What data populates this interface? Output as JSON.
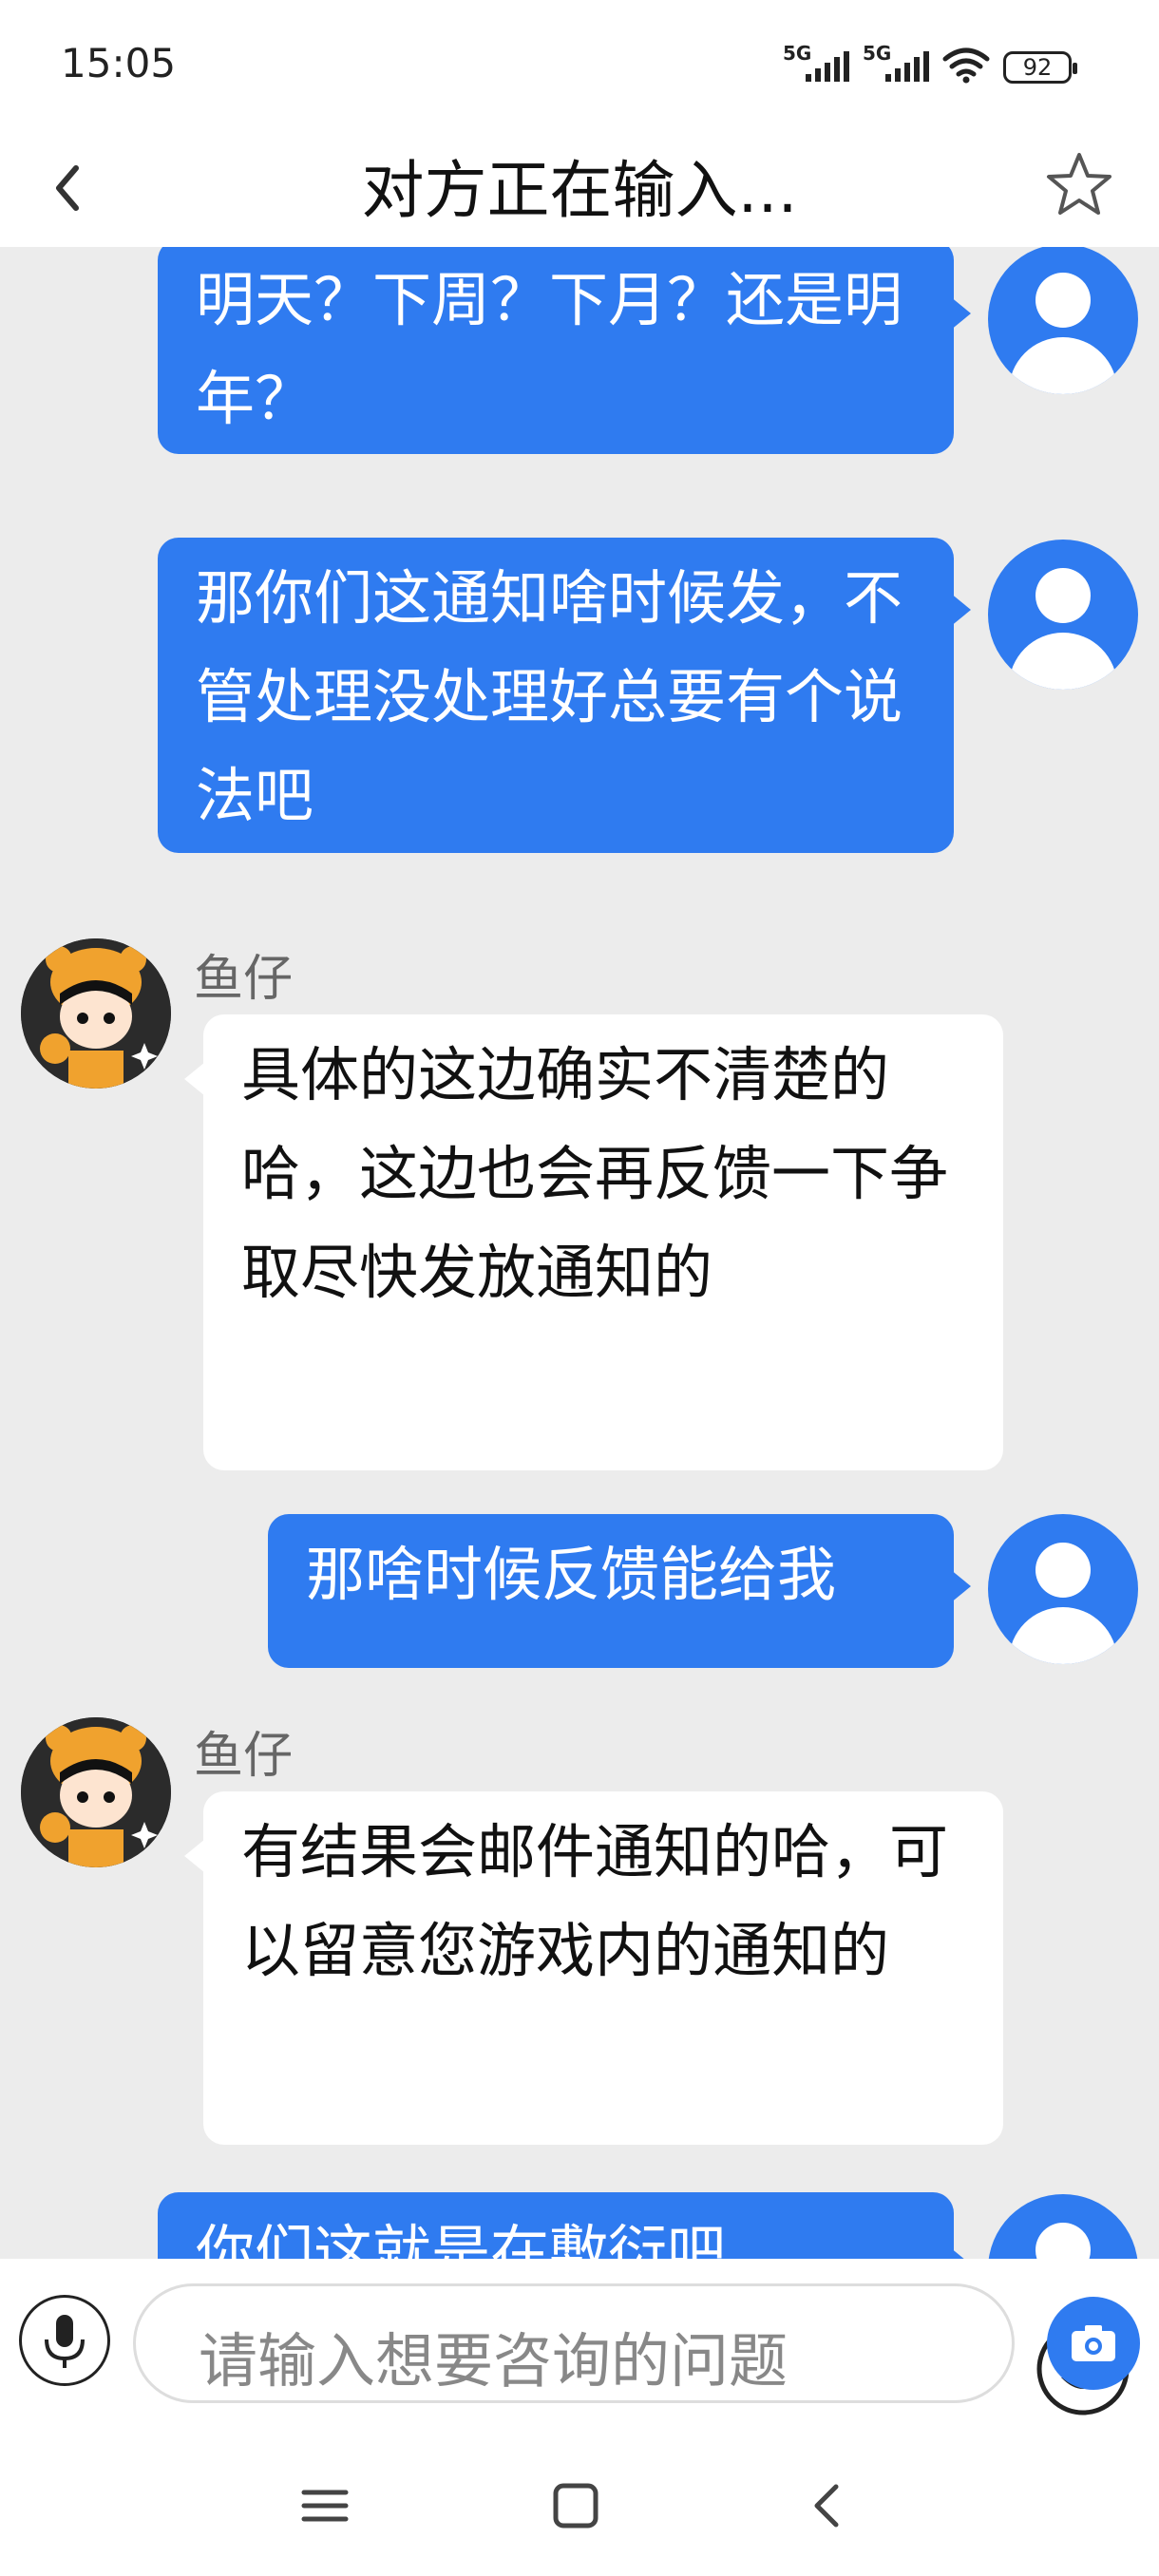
{
  "status_bar": {
    "time": "15:05",
    "signal1_label": "5G",
    "signal2_label": "5G",
    "battery": "92"
  },
  "header": {
    "title": "对方正在输入..."
  },
  "messages": [
    {
      "from": "user",
      "text": "明天？下周？下月？还是明年？"
    },
    {
      "from": "user",
      "text": "那你们这通知啥时候发，不管处理没处理好总要有个说法吧"
    },
    {
      "from": "agent",
      "sender": "鱼仔",
      "text": "具体的这边确实不清楚的哈，这边也会再反馈一下争取尽快发放通知的"
    },
    {
      "from": "user",
      "text": "那啥时候反馈能给我"
    },
    {
      "from": "agent",
      "sender": "鱼仔",
      "text": "有结果会邮件通知的哈，可以留意您游戏内的通知的"
    },
    {
      "from": "user",
      "text": "你们这就是在敷衍吧"
    }
  ],
  "input": {
    "placeholder": "请输入想要咨询的问题"
  },
  "colors": {
    "accent": "#2f7bf0",
    "chat_background": "#ececec"
  },
  "icons": [
    "back-icon",
    "star-icon",
    "mic-icon",
    "emoji-icon",
    "camera-icon",
    "menu-icon",
    "home-icon",
    "nav-back-icon"
  ]
}
